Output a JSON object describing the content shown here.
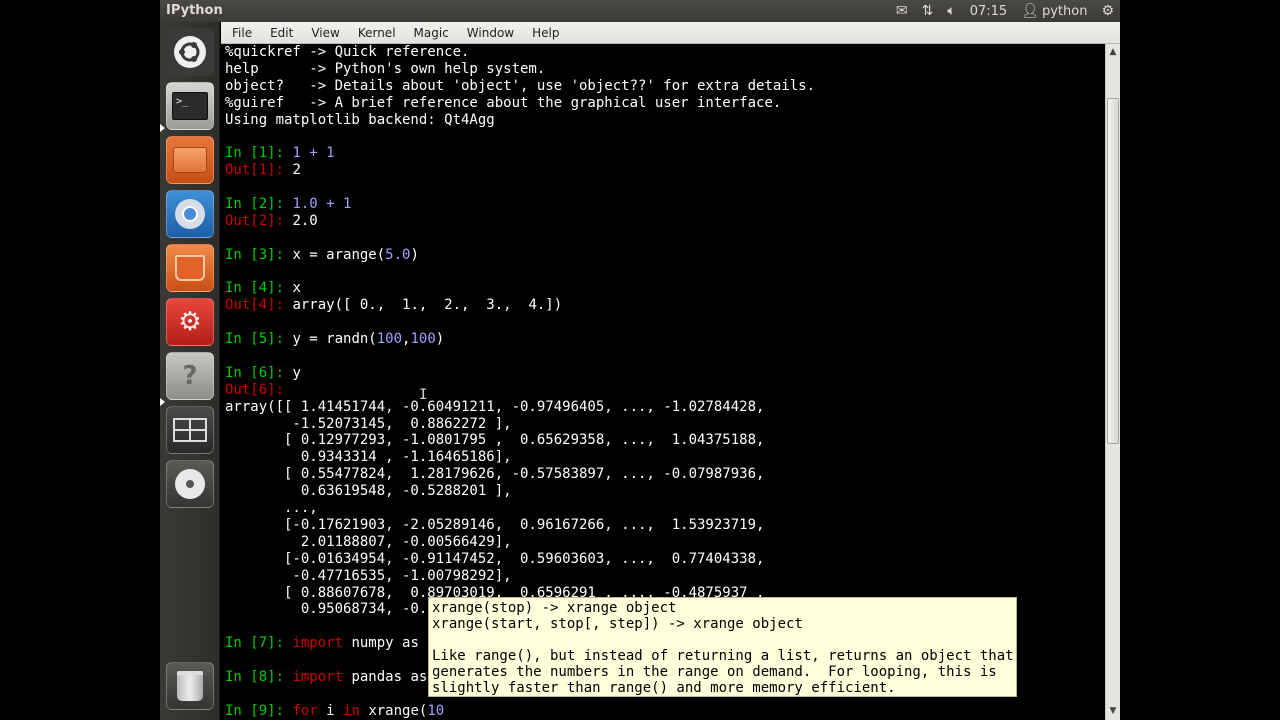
{
  "window": {
    "title": "IPython"
  },
  "panel": {
    "clock": "07:15",
    "user": "python"
  },
  "menu": [
    "File",
    "Edit",
    "View",
    "Kernel",
    "Magic",
    "Window",
    "Help"
  ],
  "terminal": {
    "intro": [
      "%quickref -> Quick reference.",
      "help      -> Python's own help system.",
      "object?   -> Details about 'object', use 'object??' for extra details.",
      "%guiref   -> A brief reference about the graphical user interface.",
      "Using matplotlib backend: Qt4Agg"
    ],
    "cells": [
      {
        "in_prompt": "In [1]: ",
        "input": "1 + 1",
        "out_prompt": "Out[1]: ",
        "output": "2"
      },
      {
        "in_prompt": "In [2]: ",
        "input": "1.0 + 1",
        "out_prompt": "Out[2]: ",
        "output": "2.0"
      },
      {
        "in_prompt": "In [3]: ",
        "input_a": "x = arange(",
        "input_num": "5.0",
        "input_b": ")"
      },
      {
        "in_prompt": "In [4]: ",
        "input": "x",
        "out_prompt": "Out[4]: ",
        "output": "array([ 0.,  1.,  2.,  3.,  4.])"
      },
      {
        "in_prompt": "In [5]: ",
        "input_a": "y = randn(",
        "input_num1": "100",
        "input_comma": ",",
        "input_num2": "100",
        "input_b": ")"
      },
      {
        "in_prompt": "In [6]: ",
        "input": "y",
        "out_prompt": "Out[6]: "
      }
    ],
    "array_output": [
      "array([[ 1.41451744, -0.60491211, -0.97496405, ..., -1.02784428,",
      "        -1.52073145,  0.8862272 ],",
      "       [ 0.12977293, -1.0801795 ,  0.65629358, ...,  1.04375188,",
      "         0.9343314 , -1.16465186],",
      "       [ 0.55477824,  1.28179626, -0.57583897, ..., -0.07987936,",
      "         0.63619548, -0.5288201 ],",
      "       ...,",
      "       [-0.17621903, -2.05289146,  0.96167266, ...,  1.53923719,",
      "         2.01188807, -0.00566429],",
      "       [-0.01634954, -0.91147452,  0.59603603, ...,  0.77404338,",
      "        -0.47716535, -1.00798292],",
      "       [ 0.88607678,  0.89703019,  0.6596291 , ..., -0.4875937 ,",
      "         0.95068734, -0."
    ],
    "later": [
      {
        "in_prompt": "In [7]: ",
        "keyword": "import",
        "rest": " numpy as"
      },
      {
        "in_prompt": "In [8]: ",
        "keyword": "import",
        "rest": " pandas as"
      },
      {
        "in_prompt": "In [9]: ",
        "keyword": "for",
        "rest_a": " i ",
        "keyword2": "in",
        "rest_b": " xrange(",
        "num": "10"
      }
    ]
  },
  "tooltip": {
    "lines": [
      "xrange(stop) -> xrange object",
      "xrange(start, stop[, step]) -> xrange object",
      "",
      "Like range(), but instead of returning a list, returns an object that",
      "generates the numbers in the range on demand.  For looping, this is",
      "slightly faster than range() and more memory efficient."
    ]
  },
  "icons": {
    "launcher": [
      "ubuntu-logo-icon",
      "terminal-icon",
      "files-icon",
      "chromium-icon",
      "software-center-icon",
      "settings-icon",
      "help-icon",
      "workspaces-icon",
      "dvd-icon",
      "trash-icon"
    ],
    "panel": [
      "mail-icon",
      "network-icon",
      "volume-icon",
      "user-icon",
      "power-gear-icon"
    ]
  }
}
